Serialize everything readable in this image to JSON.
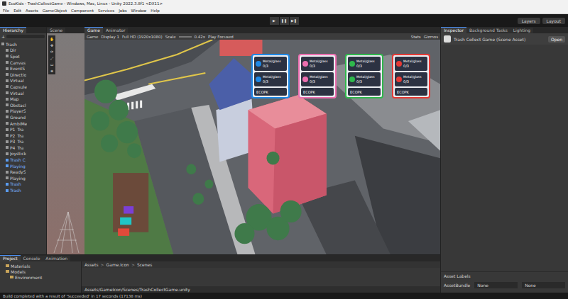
{
  "window": {
    "title": "EcoKids - TrashCollectGame - Windows, Mac, Linux - Unity 2022.3.8f1 <DX11>"
  },
  "menu": [
    "File",
    "Edit",
    "Assets",
    "GameObject",
    "Component",
    "Services",
    "Jobs",
    "Window",
    "Help"
  ],
  "toolbar": {
    "play": "▶",
    "pause": "❚❚",
    "step": "▶❚",
    "layers": "Layers",
    "layout": "Layout"
  },
  "hierarchy": {
    "tab": "Hierarchy",
    "add": "+",
    "items": [
      {
        "label": "Trash",
        "depth": 0,
        "prefab": false
      },
      {
        "label": "Dir",
        "depth": 1,
        "prefab": false
      },
      {
        "label": "Spot",
        "depth": 1,
        "prefab": false
      },
      {
        "label": "Canvas",
        "depth": 1,
        "prefab": false
      },
      {
        "label": "EventS",
        "depth": 1,
        "prefab": false
      },
      {
        "label": "Directio",
        "depth": 1,
        "prefab": false
      },
      {
        "label": "Virtual",
        "depth": 1,
        "prefab": false
      },
      {
        "label": "Capsule",
        "depth": 1,
        "prefab": false
      },
      {
        "label": "Virtual",
        "depth": 1,
        "prefab": false
      },
      {
        "label": "Map",
        "depth": 1,
        "prefab": false
      },
      {
        "label": "Obstacl",
        "depth": 1,
        "prefab": false
      },
      {
        "label": "PlayerS",
        "depth": 1,
        "prefab": false
      },
      {
        "label": "Ground",
        "depth": 1,
        "prefab": false
      },
      {
        "label": "AmbiMe",
        "depth": 1,
        "prefab": false
      },
      {
        "label": "P1_Tra",
        "depth": 1,
        "prefab": false
      },
      {
        "label": "P2_Tra",
        "depth": 1,
        "prefab": false
      },
      {
        "label": "P3_Tra",
        "depth": 1,
        "prefab": false
      },
      {
        "label": "P4_Tra",
        "depth": 1,
        "prefab": false
      },
      {
        "label": "Joystick",
        "depth": 1,
        "prefab": false
      },
      {
        "label": "Trash C",
        "depth": 1,
        "prefab": true
      },
      {
        "label": "Playing",
        "depth": 1,
        "prefab": true
      },
      {
        "label": "ReadyS",
        "depth": 1,
        "prefab": false
      },
      {
        "label": "Playing",
        "depth": 1,
        "prefab": false
      },
      {
        "label": "Trash",
        "depth": 1,
        "prefab": true
      },
      {
        "label": "Trash",
        "depth": 1,
        "prefab": true
      }
    ]
  },
  "scene": {
    "tab": "Scene",
    "tools": [
      "✋",
      "✥",
      "⟳",
      "⤢",
      "▭",
      "⊕"
    ]
  },
  "game": {
    "tabs": [
      {
        "label": "Game",
        "selected": true
      },
      {
        "label": "Animator",
        "selected": false
      }
    ],
    "bar": {
      "mode": "Game",
      "display": "Display 1",
      "resolution": "Full HD (1920x1080)",
      "scale_label": "Scale",
      "scale": "0.42x",
      "play": "Play Focused",
      "stats": "Stats",
      "gizmos": "Gizmos"
    }
  },
  "hud": [
    {
      "color": "#1e88e5",
      "rows": [
        {
          "label": "Metal/glass",
          "count": "0/3"
        },
        {
          "label": "Metal/glass",
          "count": "0/3"
        }
      ],
      "footer": "ECOPK"
    },
    {
      "color": "#ec6fb0",
      "rows": [
        {
          "label": "Metal/glass",
          "count": "0/3"
        },
        {
          "label": "Metal/glass",
          "count": "0/3"
        }
      ],
      "footer": "ECOPK"
    },
    {
      "color": "#2fb84c",
      "rows": [
        {
          "label": "Metal/glass",
          "count": "0/3"
        },
        {
          "label": "Metal/glass",
          "count": "0/3"
        }
      ],
      "footer": "ECOPK"
    },
    {
      "color": "#e53935",
      "rows": [
        {
          "label": "Metal/glass",
          "count": "0/3"
        },
        {
          "label": "Metal/glass",
          "count": "0/3"
        }
      ],
      "footer": "ECOPK"
    }
  ],
  "inspector": {
    "tabs": [
      {
        "label": "Inspector",
        "selected": true
      },
      {
        "label": "Background Tasks",
        "selected": false
      },
      {
        "label": "Lighting",
        "selected": false
      }
    ],
    "title": "Trash Collect Game (Scene Asset)",
    "open": "Open",
    "asset_labels": "Asset Labels",
    "asset_bundle": {
      "label": "AssetBundle",
      "value": "None",
      "variant": "None"
    }
  },
  "project": {
    "tabs": [
      {
        "label": "Project",
        "selected": true
      },
      {
        "label": "Console",
        "selected": false
      },
      {
        "label": "Animation",
        "selected": false
      }
    ],
    "folders": [
      {
        "label": "Materials",
        "depth": 1
      },
      {
        "label": "Models",
        "depth": 1
      },
      {
        "label": "Environment",
        "depth": 2
      }
    ],
    "breadcrumb": [
      "Assets",
      "Game.Icon",
      "Scenes"
    ],
    "separator": ">",
    "path": "Assets/GameIcon/Scenes/TrashCollectGame.unity"
  },
  "status": "Build completed with a result of 'Succeeded' in 17 seconds (17138 ms)"
}
